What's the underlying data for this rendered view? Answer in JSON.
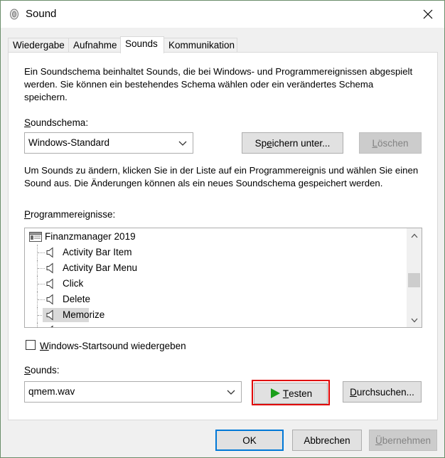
{
  "window": {
    "title": "Sound",
    "close_glyph": "✕"
  },
  "tabs": [
    {
      "label": "Wiedergabe",
      "active": false
    },
    {
      "label": "Aufnahme",
      "active": false
    },
    {
      "label": "Sounds",
      "active": true
    },
    {
      "label": "Kommunikation",
      "active": false
    }
  ],
  "sounds_tab": {
    "description1": "Ein Soundschema beinhaltet Sounds, die bei Windows- und Programmereignissen abgespielt werden. Sie können ein bestehendes Schema wählen oder ein verändertes Schema speichern.",
    "scheme_label_u": "S",
    "scheme_label_rest": "oundschema:",
    "scheme_value": "Windows-Standard",
    "save_as_pre": "Sp",
    "save_as_u": "e",
    "save_as_post": "ichern unter...",
    "delete_u": "L",
    "delete_rest": "öschen",
    "description2": "Um Sounds zu ändern, klicken Sie in der Liste auf ein Programmereignis und wählen Sie einen Sound aus. Die Änderungen können als ein neues Soundschema gespeichert werden.",
    "events_label_u": "P",
    "events_label_rest": "rogrammereignisse:",
    "events": {
      "group": "Finanzmanager 2019",
      "items": [
        {
          "label": "Activity Bar Item",
          "selected": false
        },
        {
          "label": "Activity Bar Menu",
          "selected": false
        },
        {
          "label": "Click",
          "selected": false
        },
        {
          "label": "Delete",
          "selected": false
        },
        {
          "label": "Memorize",
          "selected": true
        }
      ]
    },
    "startup_sound_u": "W",
    "startup_sound_rest": "indows-Startsound wiedergeben",
    "startup_sound_checked": false,
    "sounds_label_u": "S",
    "sounds_label_rest": "ounds:",
    "sound_value": "qmem.wav",
    "test_u": "T",
    "test_rest": "esten",
    "browse_u": "D",
    "browse_rest": "urchsuchen..."
  },
  "footer": {
    "ok": "OK",
    "cancel": "Abbrechen",
    "apply_u": "Ü",
    "apply_rest": "bernehmen"
  },
  "colors": {
    "accent": "#0078d7",
    "highlight": "#e00000",
    "play": "#1a9e1a"
  }
}
